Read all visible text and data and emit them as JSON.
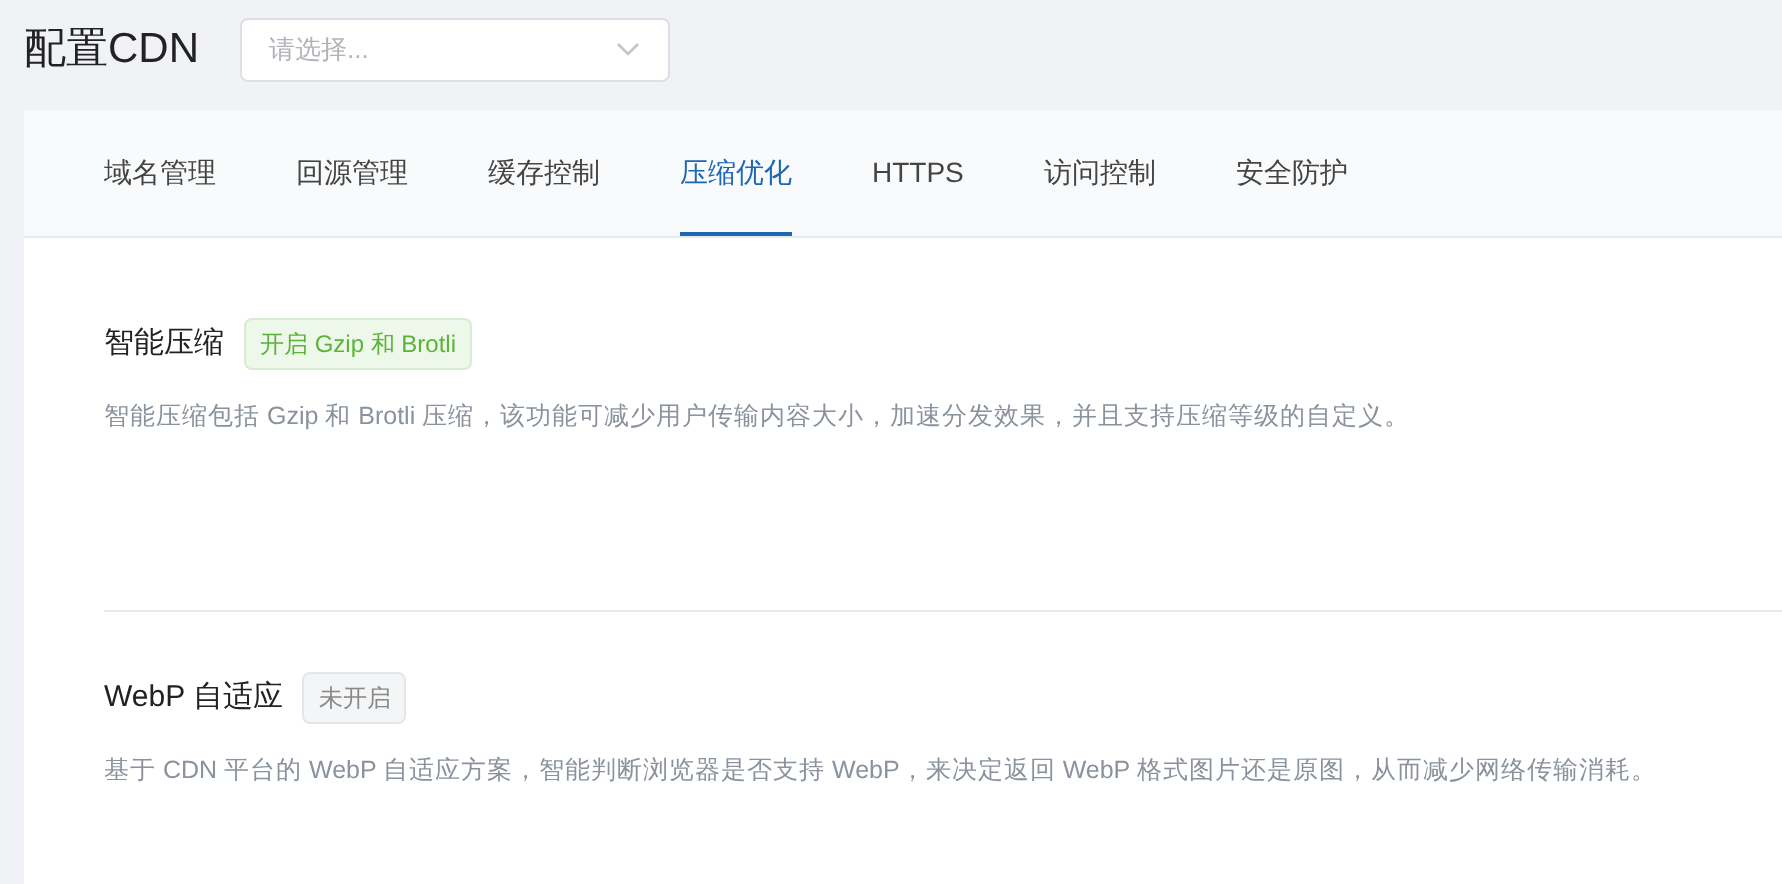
{
  "page_title": "配置CDN",
  "domain_select": {
    "placeholder": "请选择..."
  },
  "tabs": [
    {
      "label": "域名管理",
      "selected": false
    },
    {
      "label": "回源管理",
      "selected": false
    },
    {
      "label": "缓存控制",
      "selected": false
    },
    {
      "label": "压缩优化",
      "selected": true
    },
    {
      "label": "HTTPS",
      "selected": false
    },
    {
      "label": "访问控制",
      "selected": false
    },
    {
      "label": "安全防护",
      "selected": false
    }
  ],
  "features": [
    {
      "title": "智能压缩",
      "status": "开启 Gzip 和 Brotli",
      "on": true,
      "description": "智能压缩包括 Gzip 和 Brotli 压缩，该功能可减少用户传输内容大小，加速分发效果，并且支持压缩等级的自定义。"
    },
    {
      "title": "WebP 自适应",
      "status": "未开启",
      "on": false,
      "description": "基于 CDN 平台的 WebP 自适应方案，智能判断浏览器是否支持 WebP，来决定返回 WebP 格式图片还是原图，从而减少网络传输消耗。"
    }
  ]
}
